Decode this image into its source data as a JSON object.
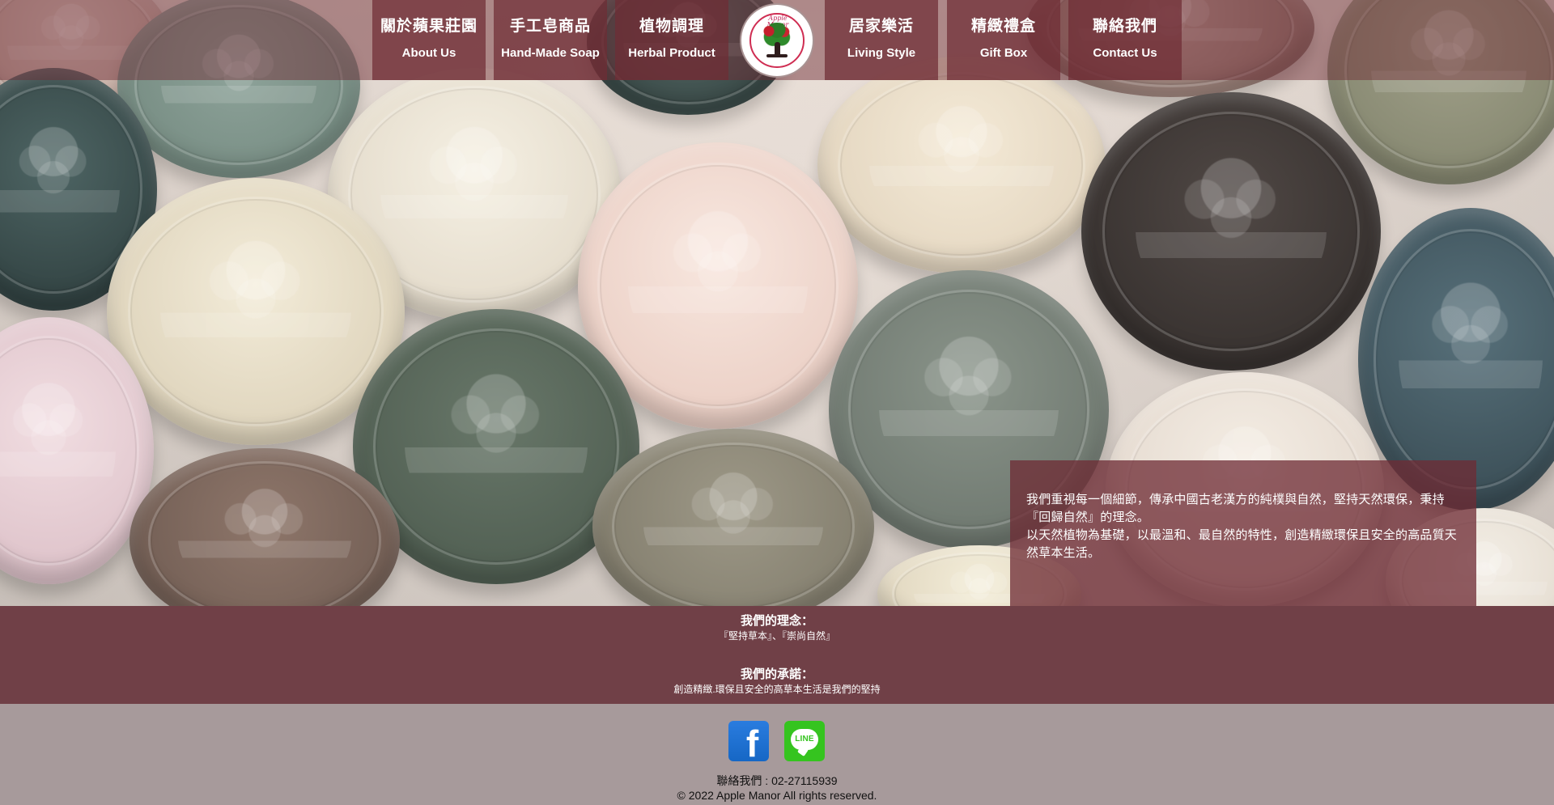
{
  "navigation": {
    "items": [
      {
        "zh": "關於蘋果莊園",
        "en": "About Us"
      },
      {
        "zh": "手工皂商品",
        "en": "Hand-Made Soap"
      },
      {
        "zh": "植物調理",
        "en": "Herbal Product"
      },
      {
        "zh": "居家樂活",
        "en": "Living Style"
      },
      {
        "zh": "精緻禮盒",
        "en": "Gift Box"
      },
      {
        "zh": "聯絡我們",
        "en": "Contact Us"
      }
    ]
  },
  "logo": {
    "name": "Apple Manor"
  },
  "hero": {
    "paragraph_1": "我們重視每一個細節，傳承中國古老漢方的純樸與自然，堅持天然環保，秉持『回歸自然』的理念。",
    "paragraph_2": "以天然植物為基礎，以最溫和、最自然的特性，創造精緻環保且安全的高品質天然草本生活。"
  },
  "mission": {
    "philosophy_heading": "我們的理念：",
    "philosophy_text": "『堅持草本』、『崇尚自然』",
    "promise_heading": "我們的承諾：",
    "promise_text": "創造精緻.環保且安全的高草本生活是我們的堅持"
  },
  "social": {
    "facebook_icon": "facebook-icon",
    "line_icon": "line-icon",
    "line_label": "LINE"
  },
  "footer": {
    "contact": "聯絡我們 : 02-27115939",
    "copyright": "© 2022 Apple Manor All rights reserved."
  },
  "colors": {
    "nav_overlay": "#6f2c34",
    "mission_band": "#704047",
    "footer_bg": "#a79a9b",
    "facebook": "#1d71d7",
    "line": "#35c41f",
    "logo_red": "#cf2d52"
  }
}
